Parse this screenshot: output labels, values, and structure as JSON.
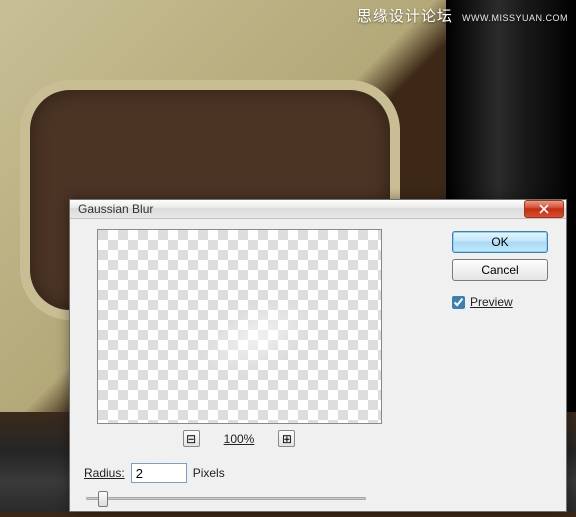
{
  "watermark": {
    "text": "思缘设计论坛",
    "sub": "WWW.MISSYUAN.COM"
  },
  "dialog": {
    "title": "Gaussian Blur",
    "ok_label": "OK",
    "cancel_label": "Cancel",
    "preview_label": "Preview",
    "preview_checked": true,
    "zoom_value": "100%",
    "zoom_out_glyph": "⊟",
    "zoom_in_glyph": "⊞",
    "radius_label": "Radius:",
    "radius_value": "2",
    "radius_unit": "Pixels"
  }
}
